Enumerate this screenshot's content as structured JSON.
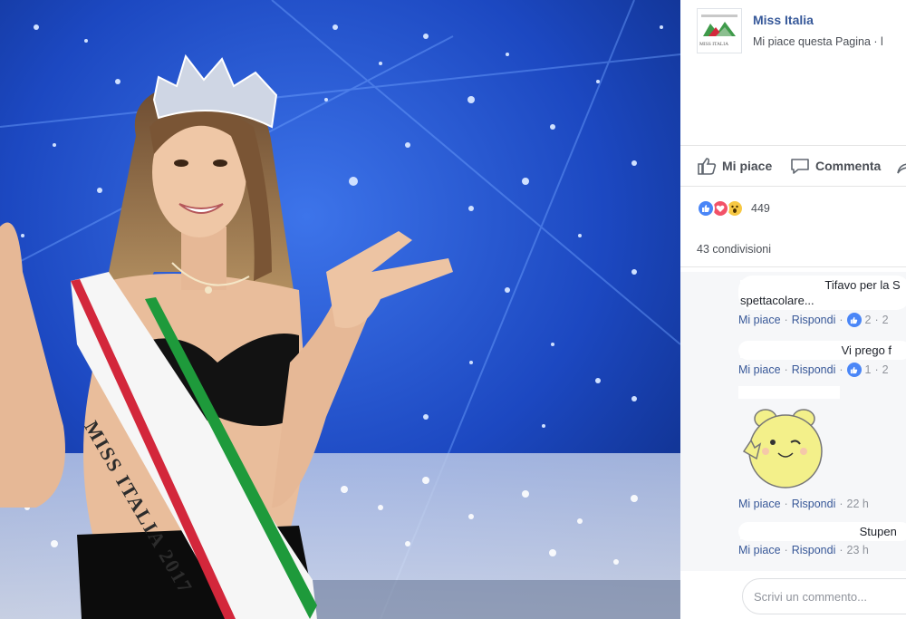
{
  "post_photo": {
    "sash_text": "MISS ITALIA 2017",
    "colors": {
      "stage_blue": "#1f4fc4",
      "sash_green": "#1e9a3b",
      "sash_red": "#d3273b"
    }
  },
  "page": {
    "name": "Miss Italia",
    "subtitle": "Mi piace questa Pagina · l",
    "logo_icon": "miss-italia-logo",
    "logo_text": "MISS ITALIA"
  },
  "actions": {
    "like_label": "Mi piace",
    "comment_label": "Commenta",
    "share_icon": "share-icon"
  },
  "reactions": {
    "icons": [
      "like-reaction-icon",
      "love-reaction-icon",
      "wow-reaction-icon"
    ],
    "count": "449"
  },
  "shares": {
    "label": "43 condivisioni"
  },
  "comments": [
    {
      "text_line1": "Tifavo per la S",
      "text_line2": "spettacolare...",
      "like": "Mi piace",
      "reply": "Rispondi",
      "likes": "2",
      "time": "2"
    },
    {
      "text_line1": "Vi prego f",
      "like": "Mi piace",
      "reply": "Rispondi",
      "likes": "1",
      "time": "2"
    },
    {
      "sticker": "bunny-sticker-icon",
      "like": "Mi piace",
      "reply": "Rispondi",
      "time": "22 h"
    },
    {
      "text_line1": "Stupen",
      "like": "Mi piace",
      "reply": "Rispondi",
      "time": "23 h"
    }
  ],
  "composer": {
    "placeholder": "Scrivi un commento..."
  },
  "colors": {
    "link": "#365899",
    "text": "#1d2129",
    "muted": "#90949c",
    "like_blue": "#4a86f7",
    "love_red": "#f25268",
    "wow_yellow": "#f7c843"
  }
}
